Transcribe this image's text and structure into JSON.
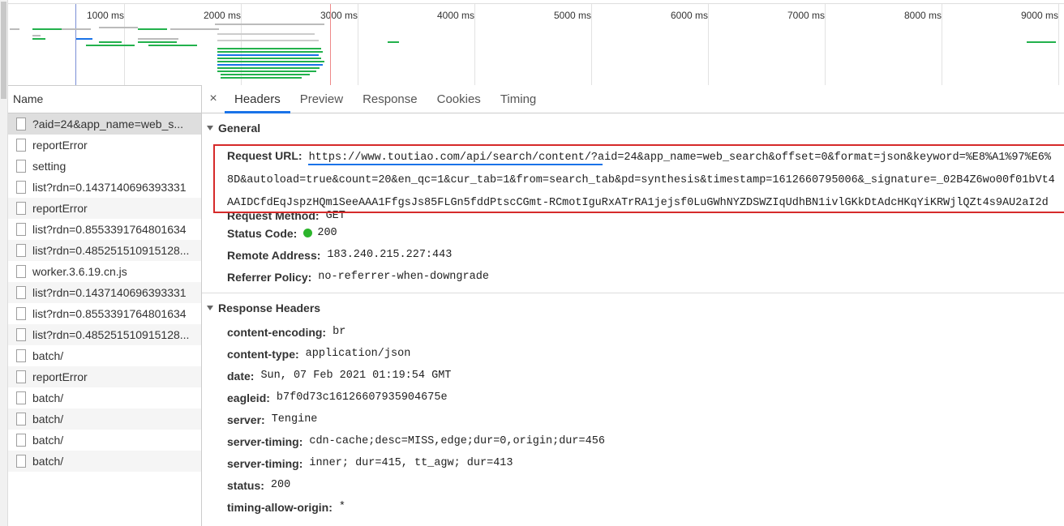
{
  "timeline": {
    "labels": [
      "1000 ms",
      "2000 ms",
      "3000 ms",
      "4000 ms",
      "5000 ms",
      "6000 ms",
      "7000 ms",
      "8000 ms",
      "9000 ms"
    ]
  },
  "requests": {
    "header": "Name",
    "items": [
      "?aid=24&app_name=web_s...",
      "reportError",
      "setting",
      "list?rdn=0.1437140696393331",
      "reportError",
      "list?rdn=0.8553391764801634",
      "list?rdn=0.485251510915128...",
      "worker.3.6.19.cn.js",
      "list?rdn=0.1437140696393331",
      "list?rdn=0.8553391764801634",
      "list?rdn=0.485251510915128...",
      "batch/",
      "reportError",
      "batch/",
      "batch/",
      "batch/",
      "batch/"
    ]
  },
  "tabs": {
    "close": "×",
    "headers": "Headers",
    "preview": "Preview",
    "response": "Response",
    "cookies": "Cookies",
    "timing": "Timing"
  },
  "general": {
    "title": "General",
    "request_url_key": "Request URL:",
    "request_url_line1": "https://www.toutiao.com/api/search/content/?aid=24&app_name=web_search&offset=0&format=json&keyword=%E8%A1%97%E6%",
    "request_url_line2": "8D&autoload=true&count=20&en_qc=1&cur_tab=1&from=search_tab&pd=synthesis&timestamp=1612660795006&_signature=_02B4Z6wo00f01bVt4",
    "request_url_line3": "AAIDCfdEqJspzHQm1SeeAAA1FfgsJs85FLGn5fddPtscCGmt-RCmotIguRxATrRA1jejsf0LuGWhNYZDSWZIqUdhBN1ivlGKkDtAdcHKqYiKRWjlQZt4s9AU2aI2d",
    "request_method_key": "Request Method:",
    "request_method": "GET",
    "status_code_key": "Status Code:",
    "status_code": "200",
    "remote_address_key": "Remote Address:",
    "remote_address": "183.240.215.227:443",
    "referrer_policy_key": "Referrer Policy:",
    "referrer_policy": "no-referrer-when-downgrade"
  },
  "response_headers": {
    "title": "Response Headers",
    "items": [
      {
        "k": "content-encoding:",
        "v": "br"
      },
      {
        "k": "content-type:",
        "v": "application/json"
      },
      {
        "k": "date:",
        "v": "Sun, 07 Feb 2021 01:19:54 GMT"
      },
      {
        "k": "eagleid:",
        "v": "b7f0d73c16126607935904675e"
      },
      {
        "k": "server:",
        "v": "Tengine"
      },
      {
        "k": "server-timing:",
        "v": "cdn-cache;desc=MISS,edge;dur=0,origin;dur=456"
      },
      {
        "k": "server-timing:",
        "v": "inner; dur=415, tt_agw; dur=413"
      },
      {
        "k": "status:",
        "v": "200"
      },
      {
        "k": "timing-allow-origin:",
        "v": "*"
      }
    ]
  },
  "colors": {
    "accent": "#1a73e8",
    "highlight_box": "#d62a2a",
    "status_ok": "#2cb52c"
  }
}
